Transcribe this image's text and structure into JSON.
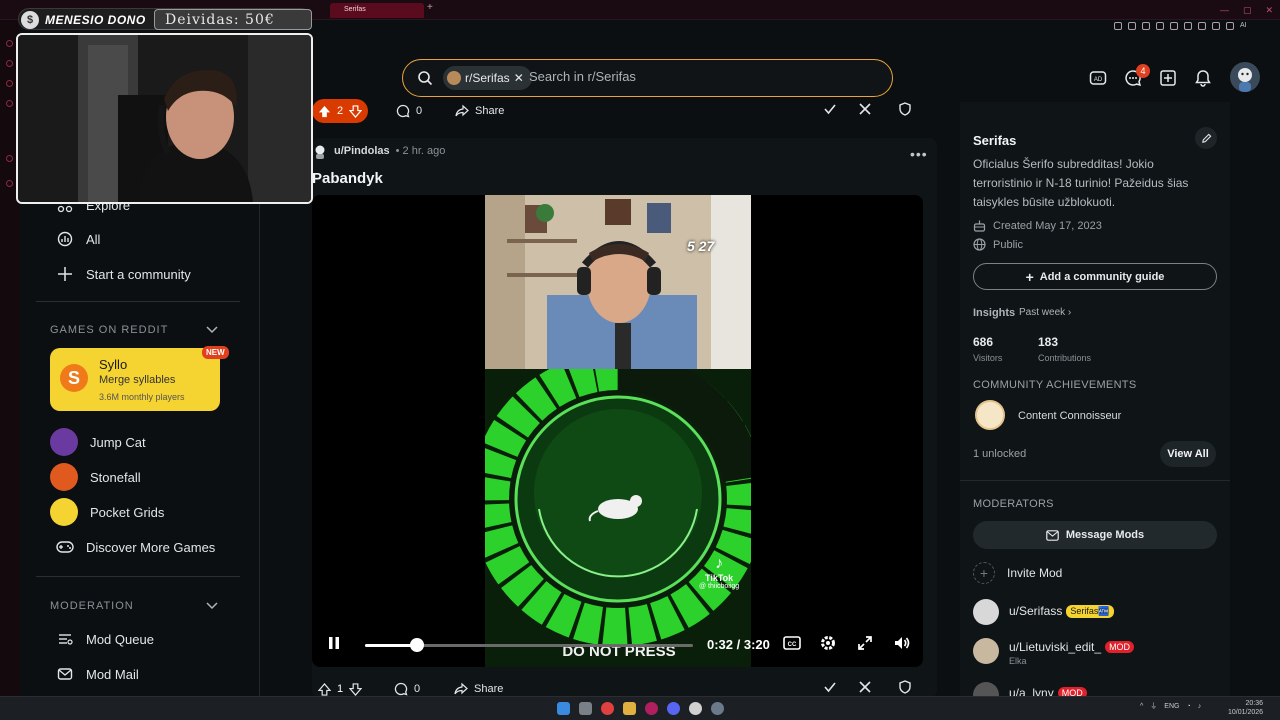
{
  "browser": {
    "active_tab": "Serifas",
    "ai_label": "AI"
  },
  "overlay": {
    "donation_name": "MENESIO DONO",
    "debt_label": "Deividas: 50€"
  },
  "header": {
    "search_chip": "r/Serifas",
    "search_placeholder": "Search in r/Serifas",
    "notification_count": "4"
  },
  "left_nav": {
    "items": [
      {
        "label": "Explore",
        "icon": "explore-icon"
      },
      {
        "label": "All",
        "icon": "all-icon"
      },
      {
        "label": "Start a community",
        "icon": "plus-icon"
      }
    ],
    "games_title": "GAMES ON REDDIT",
    "featured_game": {
      "name": "Syllo",
      "subtitle": "Merge syllables",
      "players": "3.6M monthly players",
      "badge": "NEW"
    },
    "games": [
      {
        "label": "Jump Cat",
        "color": "#6a3aa0"
      },
      {
        "label": "Stonefall",
        "color": "#e05a20"
      },
      {
        "label": "Pocket Grids",
        "color": "#f5d431"
      },
      {
        "label": "Discover More Games",
        "color": ""
      }
    ],
    "moderation_title": "MODERATION",
    "moderation_items": [
      {
        "label": "Mod Queue"
      },
      {
        "label": "Mod Mail"
      }
    ]
  },
  "feed": {
    "top_action": {
      "votes": "2",
      "comments": "0",
      "share": "Share"
    },
    "post": {
      "author": "u/Pindolas",
      "time": "• 2 hr. ago",
      "title": "Pabandyk",
      "video": {
        "game_time": "5 27",
        "button_text": "DO NOT PRESS",
        "tiktok_brand": "TikTok",
        "tiktok_handle": "@ thiicboiigg",
        "time_label": "0:32 / 3:20",
        "progress": 0.16
      }
    },
    "bottom_action": {
      "votes": "1",
      "comments": "0",
      "share": "Share"
    }
  },
  "sidebar": {
    "name": "Serifas",
    "description": "Oficialus Šerifo subredditas! Jokio terroristinio ir N-18 turinio! Pažeidus šias taisykles būsite užblokuoti.",
    "created": "Created May 17, 2023",
    "visibility": "Public",
    "guide_button": "Add a community guide",
    "insights_label": "Insights",
    "insights_period": "Past week",
    "stats": [
      {
        "value": "686",
        "label": "Visitors"
      },
      {
        "value": "183",
        "label": "Contributions"
      }
    ],
    "achievements_title": "COMMUNITY ACHIEVEMENTS",
    "achievement_name": "Content Connoisseur",
    "unlocked": "1 unlocked",
    "view_all": "View All",
    "moderators_title": "MODERATORS",
    "message_mods": "Message Mods",
    "invite_mod": "Invite Mod",
    "mods": [
      {
        "name": "u/Serifass",
        "flair": "Serifas🏧",
        "flair_style": "yellow",
        "sub": ""
      },
      {
        "name": "u/Lietuviski_edit_",
        "flair": "MOD",
        "flair_style": "red",
        "sub": "Elka"
      },
      {
        "name": "u/a_lyny",
        "flair": "MOD",
        "flair_style": "red",
        "sub": ""
      }
    ]
  },
  "taskbar": {
    "lang": "ENG",
    "time": "20:36",
    "date": "10/01/2026"
  },
  "colors": {
    "accent_orange": "#d93a00",
    "search_border": "#e8a33a",
    "syllo_yellow": "#f5d431",
    "mod_red": "#e0202a"
  }
}
